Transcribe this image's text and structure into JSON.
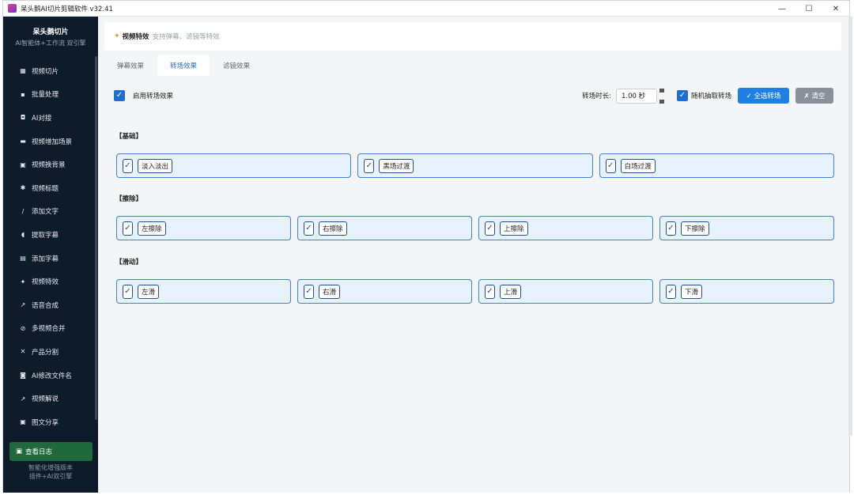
{
  "window": {
    "title": "呆头鹅AI切片剪辑软件 v32.41",
    "controls": [
      "—",
      "☐",
      "✕"
    ]
  },
  "sidebar": {
    "brand": "呆头鹅切片",
    "brand_sub": "AI智能体+工作流 双引擎",
    "items": [
      {
        "label": "视频切片",
        "icon": "film-icon",
        "glyph": "▦"
      },
      {
        "label": "批量处理",
        "icon": "box-icon",
        "glyph": "▪"
      },
      {
        "label": "AI对接",
        "icon": "robot-icon",
        "glyph": "◘"
      },
      {
        "label": "视频增加场景",
        "icon": "scene-icon",
        "glyph": "▬"
      },
      {
        "label": "视频换背景",
        "icon": "image-icon",
        "glyph": "▣"
      },
      {
        "label": "视频标题",
        "icon": "sparkle-icon",
        "glyph": "✱"
      },
      {
        "label": "添加文字",
        "icon": "pen-icon",
        "glyph": "/"
      },
      {
        "label": "提取字幕",
        "icon": "extract-icon",
        "glyph": "◖"
      },
      {
        "label": "添加字幕",
        "icon": "note-icon",
        "glyph": "▤"
      },
      {
        "label": "视频特效",
        "icon": "effect-icon",
        "glyph": "✦"
      },
      {
        "label": "语音合成",
        "icon": "mic-icon",
        "glyph": "↗"
      },
      {
        "label": "多视频合并",
        "icon": "link-icon",
        "glyph": "⊘"
      },
      {
        "label": "产品分割",
        "icon": "scissors-icon",
        "glyph": "✕"
      },
      {
        "label": "AI修改文件名",
        "icon": "rename-icon",
        "glyph": "◙"
      },
      {
        "label": "视频解说",
        "icon": "speech-icon",
        "glyph": "↗"
      },
      {
        "label": "图文分享",
        "icon": "share-icon",
        "glyph": "▣"
      }
    ],
    "log_button": "查看日志",
    "footer_line1": "智能化增强版本",
    "footer_line2": "插件+AI双引擎"
  },
  "header": {
    "title": "视频特效",
    "subtitle": "支持弹幕、滤镜等特效"
  },
  "tabs": [
    {
      "label": "弹幕效果",
      "active": false
    },
    {
      "label": "转场效果",
      "active": true
    },
    {
      "label": "滤镜效果",
      "active": false
    }
  ],
  "controls": {
    "enable_label": "启用转场效果",
    "duration_label": "转场时长:",
    "duration_value": "1.00 秒",
    "random_label": "随机抽取转场",
    "select_all": "✓ 全选转场",
    "clear": "✗ 清空"
  },
  "groups": [
    {
      "title": "【基础】",
      "items": [
        "淡入淡出",
        "黑场过渡",
        "白场过渡"
      ]
    },
    {
      "title": "【擦除】",
      "items": [
        "左擦除",
        "右擦除",
        "上擦除",
        "下擦除"
      ]
    },
    {
      "title": "【滑动】",
      "items": [
        "左滑",
        "右滑",
        "上滑",
        "下滑"
      ]
    }
  ],
  "colors": {
    "accent": "#1f7fe6",
    "sidebar_bg": "#0d1b2a",
    "option_bg": "#e8f2fd",
    "option_border": "#3b82e0"
  }
}
